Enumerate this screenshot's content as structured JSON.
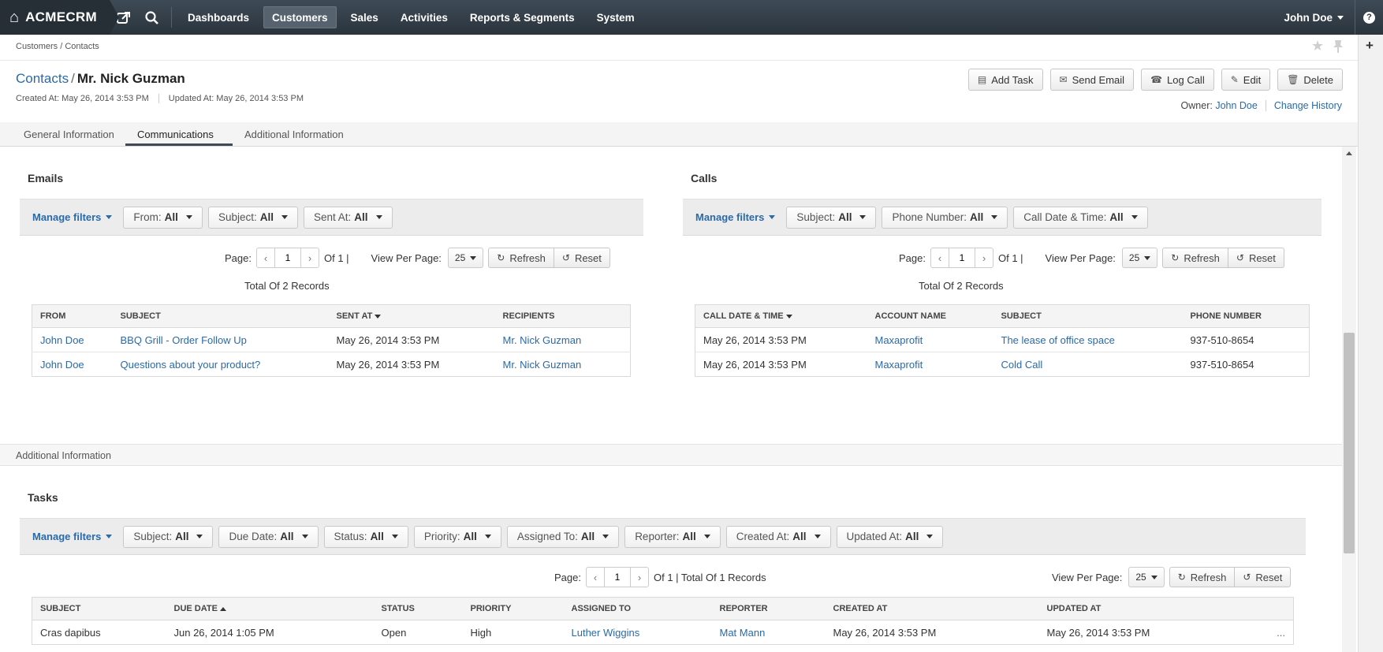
{
  "nav": {
    "brand": "ACMECRM",
    "items": [
      "Dashboards",
      "Customers",
      "Sales",
      "Activities",
      "Reports & Segments",
      "System"
    ],
    "active": "Customers",
    "user": "John Doe",
    "help": "?"
  },
  "breadcrumb": "Customers / Contacts",
  "header": {
    "crumb": "Contacts",
    "separator": "/",
    "name": "Mr. Nick Guzman",
    "created": "Created At: May 26, 2014 3:53 PM",
    "updated": "Updated At: May 26, 2014 3:53 PM",
    "owner_label": "Owner:",
    "owner": "John Doe",
    "change_history": "Change History"
  },
  "actions": {
    "add_task": "Add Task",
    "send_email": "Send Email",
    "log_call": "Log Call",
    "edit": "Edit",
    "delete": "Delete"
  },
  "tabs": [
    "General Information",
    "Communications",
    "Additional Information"
  ],
  "active_tab": "Communications",
  "common": {
    "manage_filters": "Manage filters",
    "page_label": "Page:",
    "view_per_page": "View Per Page:",
    "refresh": "Refresh",
    "reset": "Reset"
  },
  "emails": {
    "title": "Emails",
    "filters": [
      {
        "label": "From:",
        "value": "All"
      },
      {
        "label": "Subject:",
        "value": "All"
      },
      {
        "label": "Sent At:",
        "value": "All"
      }
    ],
    "page": "1",
    "of": "Of 1 |",
    "per_page": "25",
    "total": "Total Of 2 Records",
    "columns": [
      "From",
      "Subject",
      "Sent At",
      "Recipients"
    ],
    "rows": [
      [
        "John Doe",
        "BBQ Grill - Order Follow Up",
        "May 26, 2014 3:53 PM",
        "Mr. Nick Guzman"
      ],
      [
        "John Doe",
        "Questions about your product?",
        "May 26, 2014 3:53 PM",
        "Mr. Nick Guzman"
      ]
    ]
  },
  "calls": {
    "title": "Calls",
    "filters": [
      {
        "label": "Subject:",
        "value": "All"
      },
      {
        "label": "Phone Number:",
        "value": "All"
      },
      {
        "label": "Call Date & Time:",
        "value": "All"
      }
    ],
    "page": "1",
    "of": "Of 1 |",
    "per_page": "25",
    "total": "Total Of 2 Records",
    "columns": [
      "Call Date & Time",
      "Account Name",
      "Subject",
      "Phone Number"
    ],
    "rows": [
      [
        "May 26, 2014 3:53 PM",
        "Maxaprofit",
        "The lease of office space",
        "937-510-8654"
      ],
      [
        "May 26, 2014 3:53 PM",
        "Maxaprofit",
        "Cold Call",
        "937-510-8654"
      ]
    ]
  },
  "additional_info_label": "Additional Information",
  "tasks": {
    "title": "Tasks",
    "filters": [
      {
        "label": "Subject:",
        "value": "All"
      },
      {
        "label": "Due Date:",
        "value": "All"
      },
      {
        "label": "Status:",
        "value": "All"
      },
      {
        "label": "Priority:",
        "value": "All"
      },
      {
        "label": "Assigned To:",
        "value": "All"
      },
      {
        "label": "Reporter:",
        "value": "All"
      },
      {
        "label": "Created At:",
        "value": "All"
      },
      {
        "label": "Updated At:",
        "value": "All"
      }
    ],
    "page": "1",
    "of": "Of 1 | Total Of 1 Records",
    "per_page": "25",
    "columns": [
      "Subject",
      "Due Date",
      "Status",
      "Priority",
      "Assigned To",
      "Reporter",
      "Created At",
      "Updated At"
    ],
    "rows": [
      [
        "Cras dapibus",
        "Jun 26, 2014 1:05 PM",
        "Open",
        "High",
        "Luther Wiggins",
        "Mat Mann",
        "May 26, 2014 3:53 PM",
        "May 26, 2014 3:53 PM"
      ]
    ],
    "row_menu": "..."
  }
}
